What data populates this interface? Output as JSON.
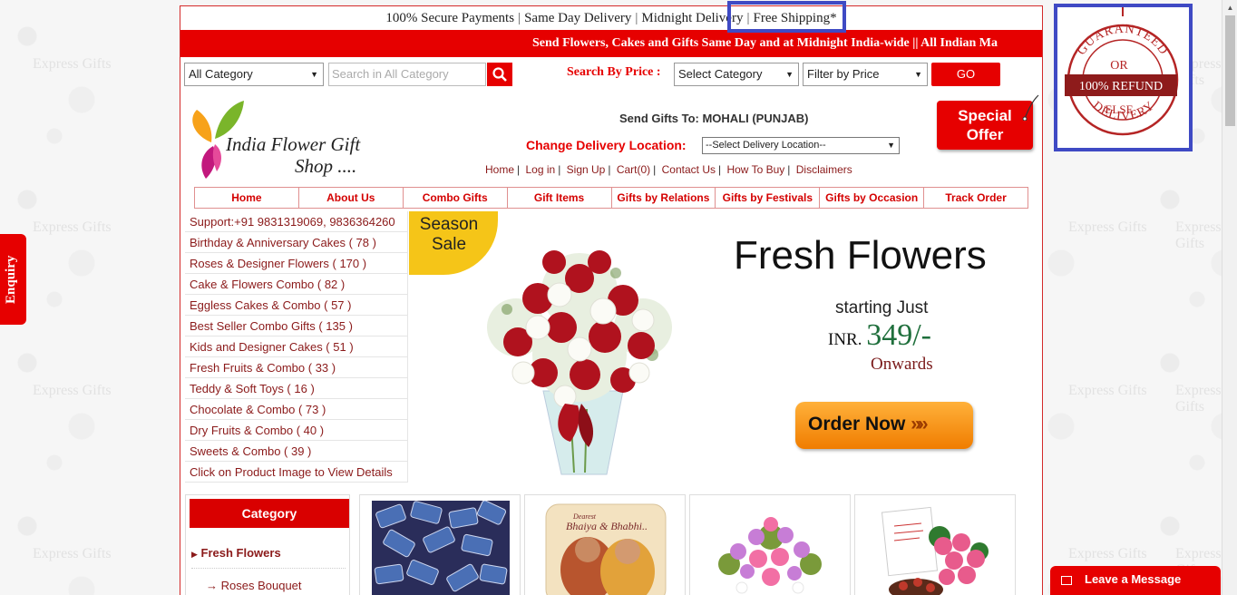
{
  "watermark_text": "Express Gifts",
  "top_bar": {
    "items": [
      "100% Secure Payments",
      "Same Day Delivery",
      "Midnight Delivery",
      "Free Shipping*"
    ]
  },
  "marquee": "Send Flowers, Cakes and Gifts Same Day and at Midnight India-wide ||   All Indian Ma",
  "search": {
    "category_value": "All Category",
    "search_placeholder": "Search in All Category",
    "price_label": "Search By Price :",
    "price_category_value": "Select Category",
    "filter_value": "Filter by Price",
    "go_label": "GO"
  },
  "logo": {
    "line1": "India Flower Gift",
    "line2": "Shop ...."
  },
  "delivery": {
    "send_to": "Send Gifts To: MOHALI (PUNJAB)",
    "change_label": "Change Delivery Location:",
    "location_value": "--Select Delivery Location--"
  },
  "links": [
    "Home",
    "Log in",
    "Sign Up",
    "Cart(0)",
    "Contact Us",
    "How To Buy",
    "Disclaimers"
  ],
  "special_offer": {
    "line1": "Special",
    "line2": "Offer"
  },
  "nav": [
    "Home",
    "About Us",
    "Combo Gifts",
    "Gift Items",
    "Gifts by Relations",
    "Gifts by Festivals",
    "Gifts by Occasion",
    "Track Order"
  ],
  "left_menu": {
    "support": "Support:+91 9831319069, 9836364260",
    "items": [
      "Birthday & Anniversary Cakes ( 78 )",
      "Roses & Designer Flowers ( 170 )",
      "Cake & Flowers Combo ( 82 )",
      "Eggless Cakes & Combo ( 57 )",
      "Best Seller Combo Gifts ( 135 )",
      "Kids and Designer Cakes ( 51 )",
      "Fresh Fruits & Combo ( 33 )",
      "Teddy & Soft Toys ( 16 )",
      "Chocolate & Combo ( 73 )",
      "Dry Fruits & Combo ( 40 )",
      "Sweets & Combo ( 39 )"
    ],
    "hint": "Click on Product Image to View Details"
  },
  "banner": {
    "season_line1": "Season",
    "season_line2": "Sale",
    "headline": "Fresh Flowers",
    "starting": "starting Just",
    "currency": "INR.",
    "price": "349/-",
    "onwards": "Onwards",
    "cta": "Order Now",
    "cta_chevrons": "»»"
  },
  "category": {
    "heading": "Category",
    "item1": "Fresh Flowers",
    "item2": "Roses Bouquet"
  },
  "products": {
    "p2_caption1": "Dearest",
    "p2_caption2": "Bhaiya & Bhabhi.."
  },
  "guarantee": {
    "top": "GUARANTEED",
    "or": "OR",
    "refund": "100% REFUND",
    "else": "ELSE",
    "bottom": "DELIVERY"
  },
  "enquiry": "Enquiry",
  "leave_message": "Leave a Message",
  "colors": {
    "brand_red": "#e60000",
    "highlight_blue": "#3f4ac4",
    "link_maroon": "#8b1a1a"
  }
}
